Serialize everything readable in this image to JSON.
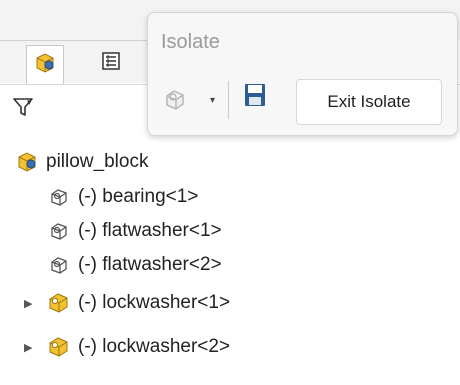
{
  "isolate_popup": {
    "title": "Isolate",
    "display_style_icon": "part-wireframe-icon",
    "save_icon": "save-icon",
    "exit_button_label": "Exit Isolate"
  },
  "tabs": [
    {
      "icon": "assembly-icon",
      "active": true
    },
    {
      "icon": "property-manager-icon",
      "active": false
    }
  ],
  "filter": {
    "icon": "filter-icon"
  },
  "tree": {
    "root": {
      "label": "pillow_block",
      "icon": "assembly-icon"
    },
    "items": [
      {
        "label": "(-) bearing<1>",
        "icon": "part-outline-icon",
        "expandable": false
      },
      {
        "label": "(-) flatwasher<1>",
        "icon": "part-outline-icon",
        "expandable": false
      },
      {
        "label": "(-) flatwasher<2>",
        "icon": "part-outline-icon",
        "expandable": false
      },
      {
        "label": "(-) lockwasher<1>",
        "icon": "subassembly-icon",
        "expandable": true
      },
      {
        "label": "(-) lockwasher<2>",
        "icon": "subassembly-icon",
        "expandable": true
      }
    ]
  },
  "colors": {
    "assembly_yellow": "#f2c230",
    "assembly_blue": "#3a6fb0",
    "save_blue": "#2e5c97"
  }
}
